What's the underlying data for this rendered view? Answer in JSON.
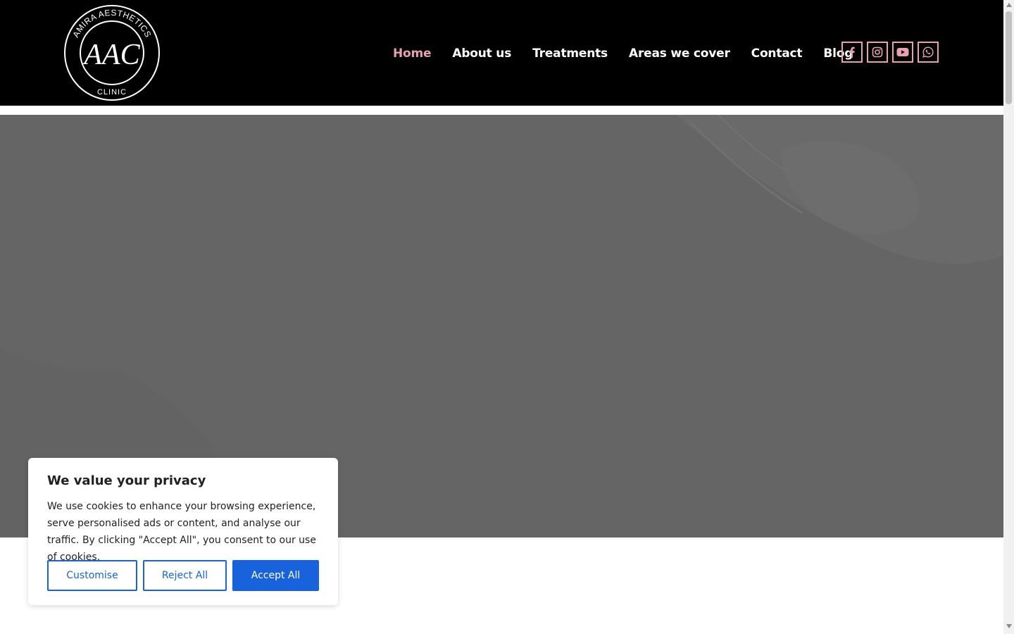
{
  "brand": {
    "logo_top_text": "AMIRA AESTHETICS",
    "logo_monogram": "AAC",
    "logo_bottom_text": "CLINIC"
  },
  "nav": {
    "items": [
      {
        "label": "Home",
        "active": true
      },
      {
        "label": "About us",
        "active": false
      },
      {
        "label": "Treatments",
        "active": false
      },
      {
        "label": "Areas we cover",
        "active": false
      },
      {
        "label": "Contact",
        "active": false
      },
      {
        "label": "Blog",
        "active": false
      }
    ]
  },
  "social": {
    "icons": [
      "facebook-icon",
      "instagram-icon",
      "youtube-icon",
      "whatsapp-icon"
    ],
    "accent": "#e8a0b4"
  },
  "colors": {
    "header_bg": "#000000",
    "hero_overlay": "#666666",
    "primary_button": "#1863dc",
    "active_nav": "#e8a0b4"
  },
  "cookie": {
    "title": "We value your privacy",
    "text": "We use cookies to enhance your browsing experience, serve personalised ads or content, and analyse our traffic. By clicking \"Accept All\", you consent to our use of cookies.",
    "customise_label": "Customise",
    "reject_label": "Reject All",
    "accept_label": "Accept All"
  }
}
